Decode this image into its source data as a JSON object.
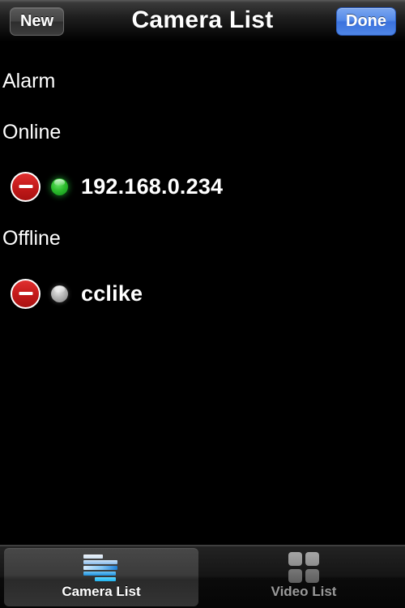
{
  "navbar": {
    "title": "Camera List",
    "left_button": "New",
    "right_button": "Done"
  },
  "sections": [
    {
      "header": "Alarm",
      "cameras": []
    },
    {
      "header": "Online",
      "cameras": [
        {
          "name": "192.168.0.234",
          "status": "online",
          "status_color": "#2dbd2d",
          "delete_label": "delete"
        }
      ]
    },
    {
      "header": "Offline",
      "cameras": [
        {
          "name": "cclike",
          "status": "offline",
          "status_color": "#b4b4b4",
          "delete_label": "delete"
        }
      ]
    }
  ],
  "tabbar": {
    "tabs": [
      {
        "label": "Camera List",
        "icon": "list-bars-icon",
        "active": true
      },
      {
        "label": "Video List",
        "icon": "grid-squares-icon",
        "active": false
      }
    ]
  },
  "colors": {
    "accent_blue": "#4f86e6",
    "delete_red": "#c41a1a",
    "online_green": "#2dbd2d",
    "offline_gray": "#b4b4b4",
    "background": "#000000"
  }
}
